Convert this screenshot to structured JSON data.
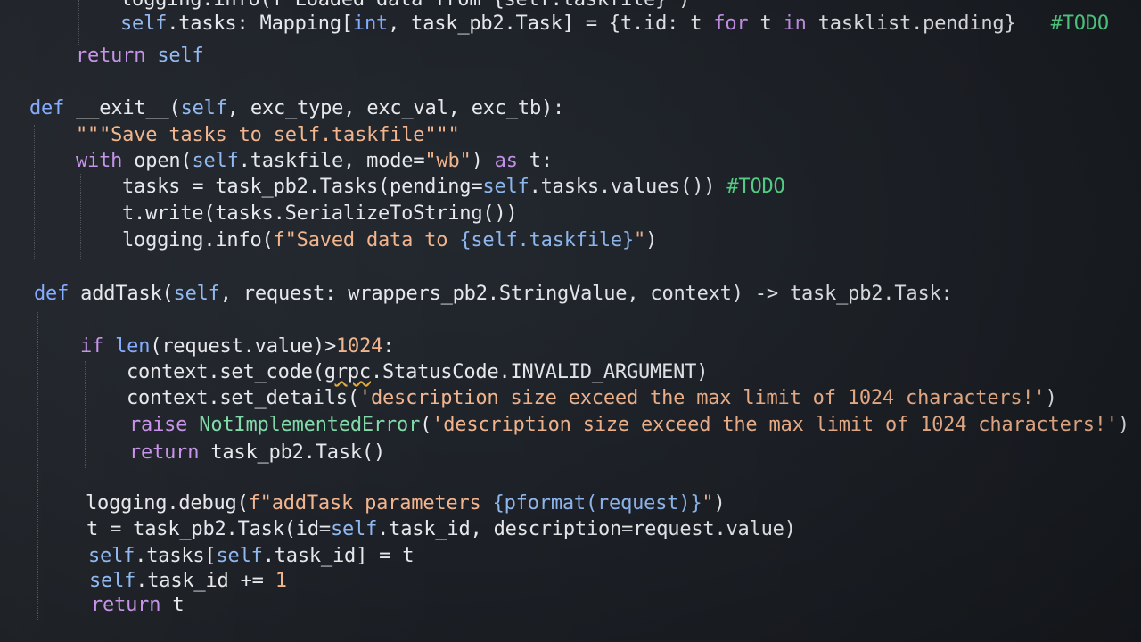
{
  "editor": {
    "lines": [
      {
        "id": "l0",
        "segments": [
          {
            "t": "logging.info(f\"Loaded data from {self.taskfile}\")",
            "c": "fn"
          }
        ]
      },
      {
        "id": "l1",
        "segments": [
          {
            "t": "self",
            "c": "slf"
          },
          {
            "t": ".tasks: Mapping[",
            "c": "fn"
          },
          {
            "t": "int",
            "c": "def"
          },
          {
            "t": ", task_pb2.Task] = {t.id: t ",
            "c": "fn"
          },
          {
            "t": "for",
            "c": "kw"
          },
          {
            "t": " t ",
            "c": "fn"
          },
          {
            "t": "in",
            "c": "kw"
          },
          {
            "t": " tasklist.pending}",
            "c": "fn"
          },
          {
            "t": "   #TODO",
            "c": "cm"
          }
        ]
      },
      {
        "id": "l2",
        "segments": [
          {
            "t": "return",
            "c": "kw"
          },
          {
            "t": " ",
            "c": "fn"
          },
          {
            "t": "self",
            "c": "slf"
          }
        ]
      },
      {
        "id": "l3",
        "segments": [
          {
            "t": "def",
            "c": "def"
          },
          {
            "t": " __exit__(",
            "c": "fn"
          },
          {
            "t": "self",
            "c": "slf"
          },
          {
            "t": ", exc_type, exc_val, exc_tb):",
            "c": "fn"
          }
        ]
      },
      {
        "id": "l4",
        "segments": [
          {
            "t": "\"\"\"Save tasks to self.taskfile\"\"\"",
            "c": "str"
          }
        ]
      },
      {
        "id": "l5",
        "segments": [
          {
            "t": "with",
            "c": "kw"
          },
          {
            "t": " open(",
            "c": "fn"
          },
          {
            "t": "self",
            "c": "slf"
          },
          {
            "t": ".taskfile, mode=",
            "c": "fn"
          },
          {
            "t": "\"wb\"",
            "c": "str"
          },
          {
            "t": ") ",
            "c": "fn"
          },
          {
            "t": "as",
            "c": "kw"
          },
          {
            "t": " t:",
            "c": "fn"
          }
        ]
      },
      {
        "id": "l6",
        "segments": [
          {
            "t": "tasks = task_pb2.Tasks(pending=",
            "c": "fn"
          },
          {
            "t": "self",
            "c": "slf"
          },
          {
            "t": ".tasks.values()) ",
            "c": "fn"
          },
          {
            "t": "#TODO",
            "c": "cm"
          }
        ]
      },
      {
        "id": "l7",
        "segments": [
          {
            "t": "t.write(tasks.SerializeToString())",
            "c": "fn"
          }
        ]
      },
      {
        "id": "l8",
        "segments": [
          {
            "t": "logging.info(",
            "c": "fn"
          },
          {
            "t": "f\"Saved data to ",
            "c": "str"
          },
          {
            "t": "{self.taskfile}",
            "c": "slf"
          },
          {
            "t": "\"",
            "c": "str"
          },
          {
            "t": ")",
            "c": "fn"
          }
        ]
      },
      {
        "id": "l9",
        "segments": [
          {
            "t": "def",
            "c": "def"
          },
          {
            "t": " addTask(",
            "c": "fn"
          },
          {
            "t": "self",
            "c": "slf"
          },
          {
            "t": ", request: wrappers_pb2.StringValue, context) -> task_pb2.Task:",
            "c": "fn"
          }
        ]
      },
      {
        "id": "l10",
        "segments": [
          {
            "t": "if",
            "c": "kw"
          },
          {
            "t": " ",
            "c": "fn"
          },
          {
            "t": "len",
            "c": "def"
          },
          {
            "t": "(request.value)>",
            "c": "fn"
          },
          {
            "t": "1024",
            "c": "num"
          },
          {
            "t": ":",
            "c": "fn"
          }
        ]
      },
      {
        "id": "l11",
        "segments": [
          {
            "t": "context.set_code(",
            "c": "fn"
          },
          {
            "t": "grpc",
            "c": "fn",
            "sq": true
          },
          {
            "t": ".StatusCode.INVALID_ARGUMENT)",
            "c": "fn"
          }
        ]
      },
      {
        "id": "l12",
        "segments": [
          {
            "t": "context.set_details(",
            "c": "fn"
          },
          {
            "t": "'description size exceed the max limit of 1024 characters!'",
            "c": "str"
          },
          {
            "t": ")",
            "c": "fn"
          }
        ]
      },
      {
        "id": "l13",
        "segments": [
          {
            "t": "raise",
            "c": "kw"
          },
          {
            "t": " ",
            "c": "fn"
          },
          {
            "t": "NotImplementedError",
            "c": "cls"
          },
          {
            "t": "(",
            "c": "fn"
          },
          {
            "t": "'description size exceed the max limit of 1024 characters!'",
            "c": "str"
          },
          {
            "t": ")",
            "c": "fn"
          }
        ]
      },
      {
        "id": "l14",
        "segments": [
          {
            "t": "return",
            "c": "kw"
          },
          {
            "t": " task_pb2.Task()",
            "c": "fn"
          }
        ]
      },
      {
        "id": "l15",
        "segments": [
          {
            "t": "logging.debug(",
            "c": "fn"
          },
          {
            "t": "f\"addTask parameters ",
            "c": "str"
          },
          {
            "t": "{pformat(request)}",
            "c": "slf"
          },
          {
            "t": "\"",
            "c": "str"
          },
          {
            "t": ")",
            "c": "fn"
          }
        ]
      },
      {
        "id": "l16",
        "segments": [
          {
            "t": "t = task_pb2.Task(id=",
            "c": "fn"
          },
          {
            "t": "self",
            "c": "slf"
          },
          {
            "t": ".task_id, description=request.value)",
            "c": "fn"
          }
        ]
      },
      {
        "id": "l17",
        "segments": [
          {
            "t": "self",
            "c": "slf"
          },
          {
            "t": ".tasks[",
            "c": "fn"
          },
          {
            "t": "self",
            "c": "slf"
          },
          {
            "t": ".task_id] = t",
            "c": "fn"
          }
        ]
      },
      {
        "id": "l18",
        "segments": [
          {
            "t": "self",
            "c": "slf"
          },
          {
            "t": ".task_id += ",
            "c": "fn"
          },
          {
            "t": "1",
            "c": "num"
          }
        ]
      },
      {
        "id": "l19",
        "segments": [
          {
            "t": "return",
            "c": "kw"
          },
          {
            "t": " t",
            "c": "fn"
          }
        ]
      }
    ]
  }
}
